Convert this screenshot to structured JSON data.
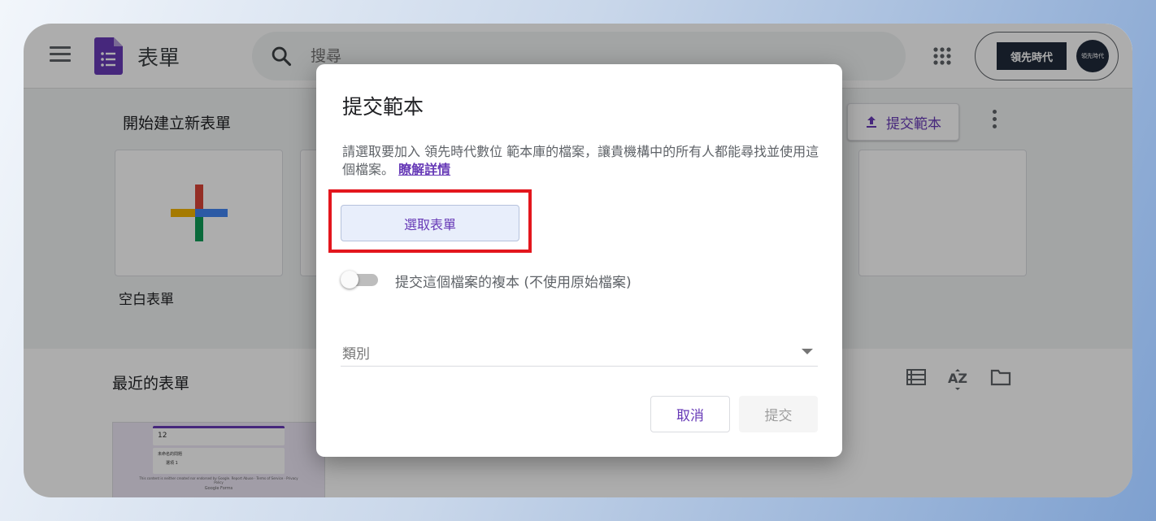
{
  "header": {
    "app_title": "表單",
    "search_placeholder": "搜尋",
    "brand_text": "領先時代",
    "avatar_text": "領先時代"
  },
  "gallery": {
    "title": "開始建立新表單",
    "blank_label": "空白表單",
    "submit_template_label": "提交範本"
  },
  "recent": {
    "title": "最近的表單",
    "thumb_title": "12",
    "thumb_question": "未命名的問題",
    "thumb_option": "選項 1",
    "thumb_footer": "This content is neither created nor endorsed by Google. Report Abuse · Terms of Service · Privacy Policy",
    "thumb_brand": "Google Forms"
  },
  "dialog": {
    "title": "提交範本",
    "description": "請選取要加入 領先時代數位 範本庫的檔案，讓貴機構中的所有人都能尋找並使用這個檔案。",
    "learn_more": "瞭解詳情",
    "select_form": "選取表單",
    "copy_toggle_label": "提交這個檔案的複本 (不使用原始檔案)",
    "category_label": "類別",
    "cancel": "取消",
    "submit": "提交"
  },
  "colors": {
    "accent": "#673ab7",
    "highlight_frame": "#e3161d"
  }
}
